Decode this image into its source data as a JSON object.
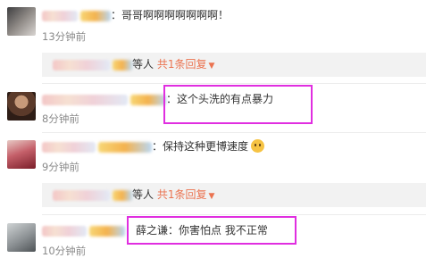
{
  "comments": [
    {
      "text": "：哥哥啊啊啊啊啊啊啊！",
      "time": "13分钟前",
      "reply": {
        "suffix": "等人",
        "count_label": "共1条回复",
        "icon": "chevron-down-icon"
      }
    },
    {
      "text": "：这个头洗的有点暴力",
      "time": "8分钟前"
    },
    {
      "text": "：保持这种更博速度",
      "emoji": "surprised-face-icon",
      "time": "9分钟前",
      "reply": {
        "suffix": "等人",
        "count_label": "共1条回复",
        "icon": "chevron-down-icon"
      }
    },
    {
      "text": "：薛之谦：你害怕点 我不正常",
      "time": "10分钟前"
    }
  ],
  "colors": {
    "highlight": "#e02ee0",
    "reply_accent": "#eb7350",
    "time": "#8a8a8a"
  }
}
